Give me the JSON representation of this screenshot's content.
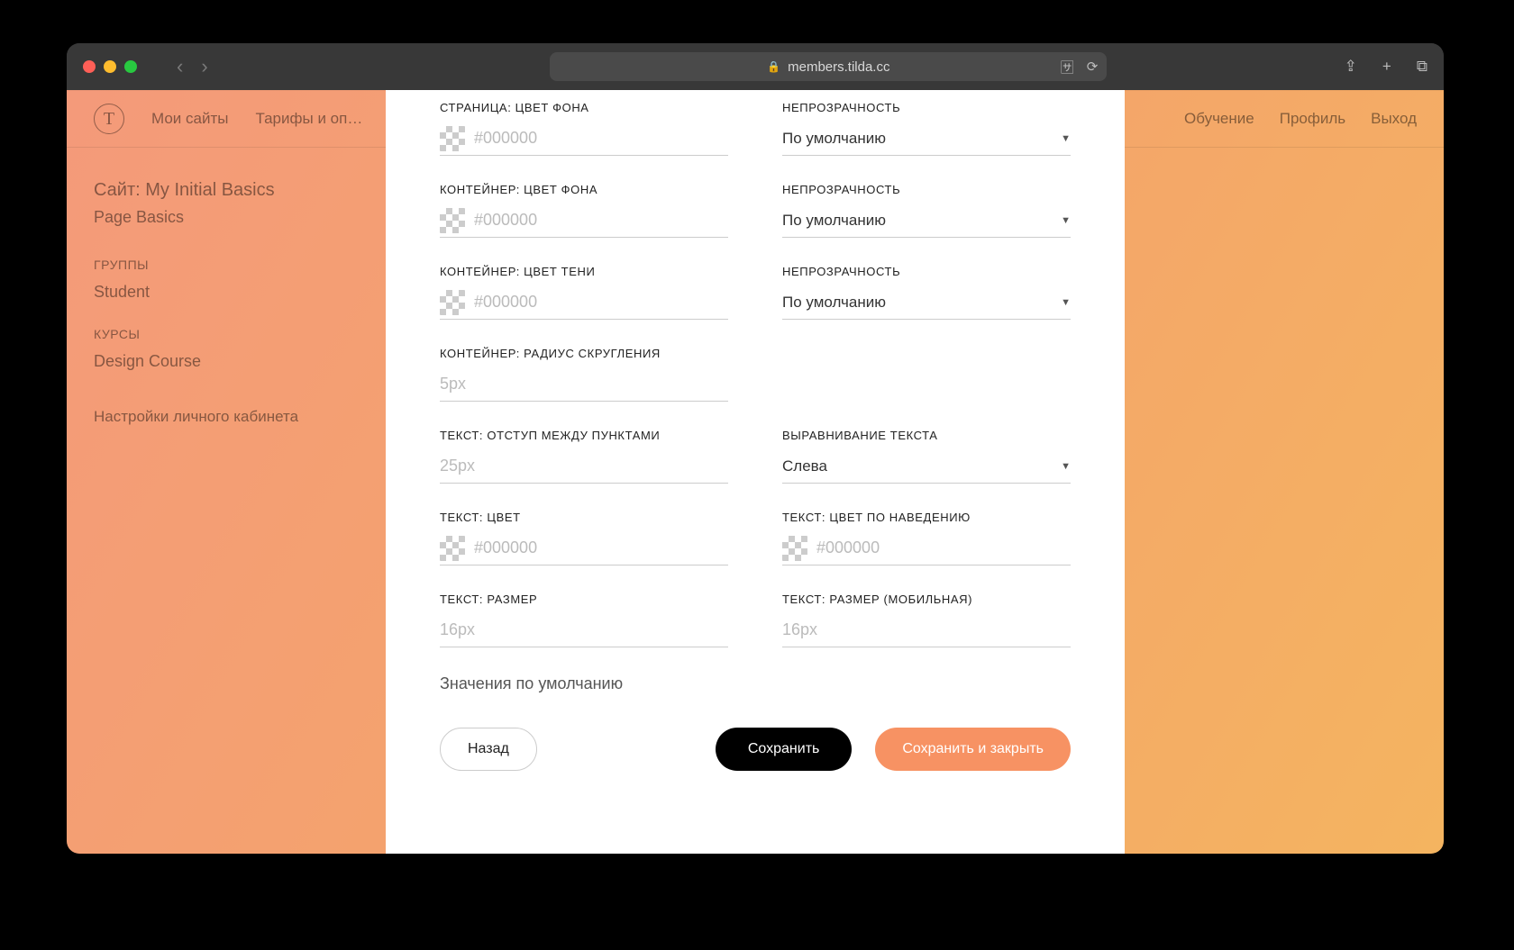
{
  "browser": {
    "url": "members.tilda.cc",
    "share_icon": "⇪",
    "plus_icon": "+",
    "tabs_icon": "⧉",
    "translate_icon": "🈂",
    "reload_icon": "⟳"
  },
  "background": {
    "logo_char": "T",
    "nav1": "Мои сайты",
    "nav2": "Тарифы и оп…",
    "nav_right1": "Обучение",
    "nav_right2": "Профиль",
    "nav_right3": "Выход",
    "sidebar_title": "Сайт: My Initial Basics",
    "sidebar_sub": "Page Basics",
    "section_groups": "ГРУППЫ",
    "group_item": "Student",
    "section_courses": "КУРСЫ",
    "course_item": "Design Course",
    "settings": "Настройки личного кабинета"
  },
  "form": {
    "page_bg_label": "СТРАНИЦА: ЦВЕТ ФОНА",
    "page_bg_placeholder": "#000000",
    "opacity_label": "НЕПРОЗРАЧНОСТЬ",
    "opacity_default": "По умолчанию",
    "container_bg_label": "КОНТЕЙНЕР: ЦВЕТ ФОНА",
    "container_bg_placeholder": "#000000",
    "container_shadow_label": "КОНТЕЙНЕР: ЦВЕТ ТЕНИ",
    "container_shadow_placeholder": "#000000",
    "container_radius_label": "КОНТЕЙНЕР: РАДИУС СКРУГЛЕНИЯ",
    "container_radius_placeholder": "5px",
    "text_gap_label": "ТЕКСТ: ОТСТУП МЕЖДУ ПУНКТАМИ",
    "text_gap_placeholder": "25px",
    "text_align_label": "ВЫРАВНИВАНИЕ ТЕКСТА",
    "text_align_value": "Слева",
    "text_color_label": "ТЕКСТ: ЦВЕТ",
    "text_color_placeholder": "#000000",
    "text_hover_label": "ТЕКСТ: ЦВЕТ ПО НАВЕДЕНИЮ",
    "text_hover_placeholder": "#000000",
    "text_size_label": "ТЕКСТ: РАЗМЕР",
    "text_size_placeholder": "16px",
    "text_size_mobile_label": "ТЕКСТ: РАЗМЕР (МОБИЛЬНАЯ)",
    "text_size_mobile_placeholder": "16px",
    "defaults_link": "Значения по умолчанию",
    "btn_back": "Назад",
    "btn_save": "Сохранить",
    "btn_save_close": "Сохранить и закрыть"
  }
}
